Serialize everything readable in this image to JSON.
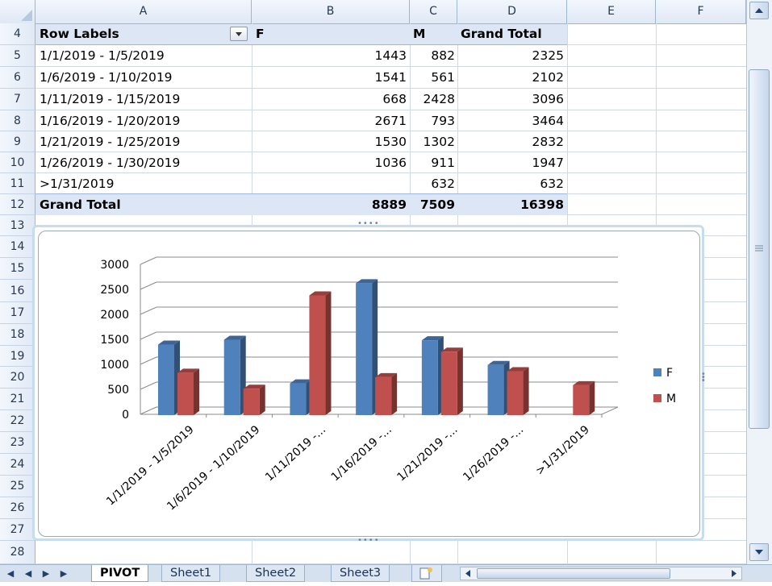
{
  "columns": [
    "A",
    "B",
    "C",
    "D",
    "E",
    "F"
  ],
  "rows": [
    "4",
    "5",
    "6",
    "7",
    "8",
    "9",
    "10",
    "11",
    "12",
    "13",
    "14",
    "15",
    "16",
    "17",
    "18",
    "19",
    "20",
    "21",
    "22",
    "23",
    "24",
    "25",
    "26",
    "27",
    "28"
  ],
  "pivot": {
    "headers": {
      "row_labels": "Row Labels",
      "f": "F",
      "m": "M",
      "grand_total": "Grand Total"
    },
    "rows": [
      {
        "label": "1/1/2019 - 1/5/2019",
        "f": "1443",
        "m": "882",
        "total": "2325"
      },
      {
        "label": "1/6/2019 - 1/10/2019",
        "f": "1541",
        "m": "561",
        "total": "2102"
      },
      {
        "label": "1/11/2019 - 1/15/2019",
        "f": "668",
        "m": "2428",
        "total": "3096"
      },
      {
        "label": "1/16/2019 - 1/20/2019",
        "f": "2671",
        "m": "793",
        "total": "3464"
      },
      {
        "label": "1/21/2019 - 1/25/2019",
        "f": "1530",
        "m": "1302",
        "total": "2832"
      },
      {
        "label": "1/26/2019 - 1/30/2019",
        "f": "1036",
        "m": "911",
        "total": "1947"
      },
      {
        "label": ">1/31/2019",
        "f": "",
        "m": "632",
        "total": "632"
      }
    ],
    "grand_total": {
      "label": "Grand Total",
      "f": "8889",
      "m": "7509",
      "total": "16398"
    }
  },
  "chart_data": {
    "type": "bar",
    "categories": [
      "1/1/2019 - 1/5/2019",
      "1/6/2019 - 1/10/2019",
      "1/11/2019 -...",
      "1/16/2019 -...",
      "1/21/2019 -...",
      "1/26/2019 -...",
      ">1/31/2019"
    ],
    "series": [
      {
        "name": "F",
        "values": [
          1443,
          1541,
          668,
          2671,
          1530,
          1036,
          0
        ],
        "color": "#4f81bd"
      },
      {
        "name": "M",
        "values": [
          882,
          561,
          2428,
          793,
          1302,
          911,
          632
        ],
        "color": "#c0504d"
      }
    ],
    "yticks": [
      "0",
      "500",
      "1000",
      "1500",
      "2000",
      "2500",
      "3000"
    ],
    "ylim": [
      0,
      3000
    ],
    "grid": true,
    "legend_position": "right",
    "style": "3d-clustered-column"
  },
  "sheet_tabs": [
    "PIVOT",
    "Sheet1",
    "Sheet2",
    "Sheet3"
  ],
  "active_tab": "PIVOT",
  "icons": {
    "nav_first": "◀",
    "nav_prev": "◀",
    "nav_next": "▶",
    "nav_last": "▶"
  }
}
